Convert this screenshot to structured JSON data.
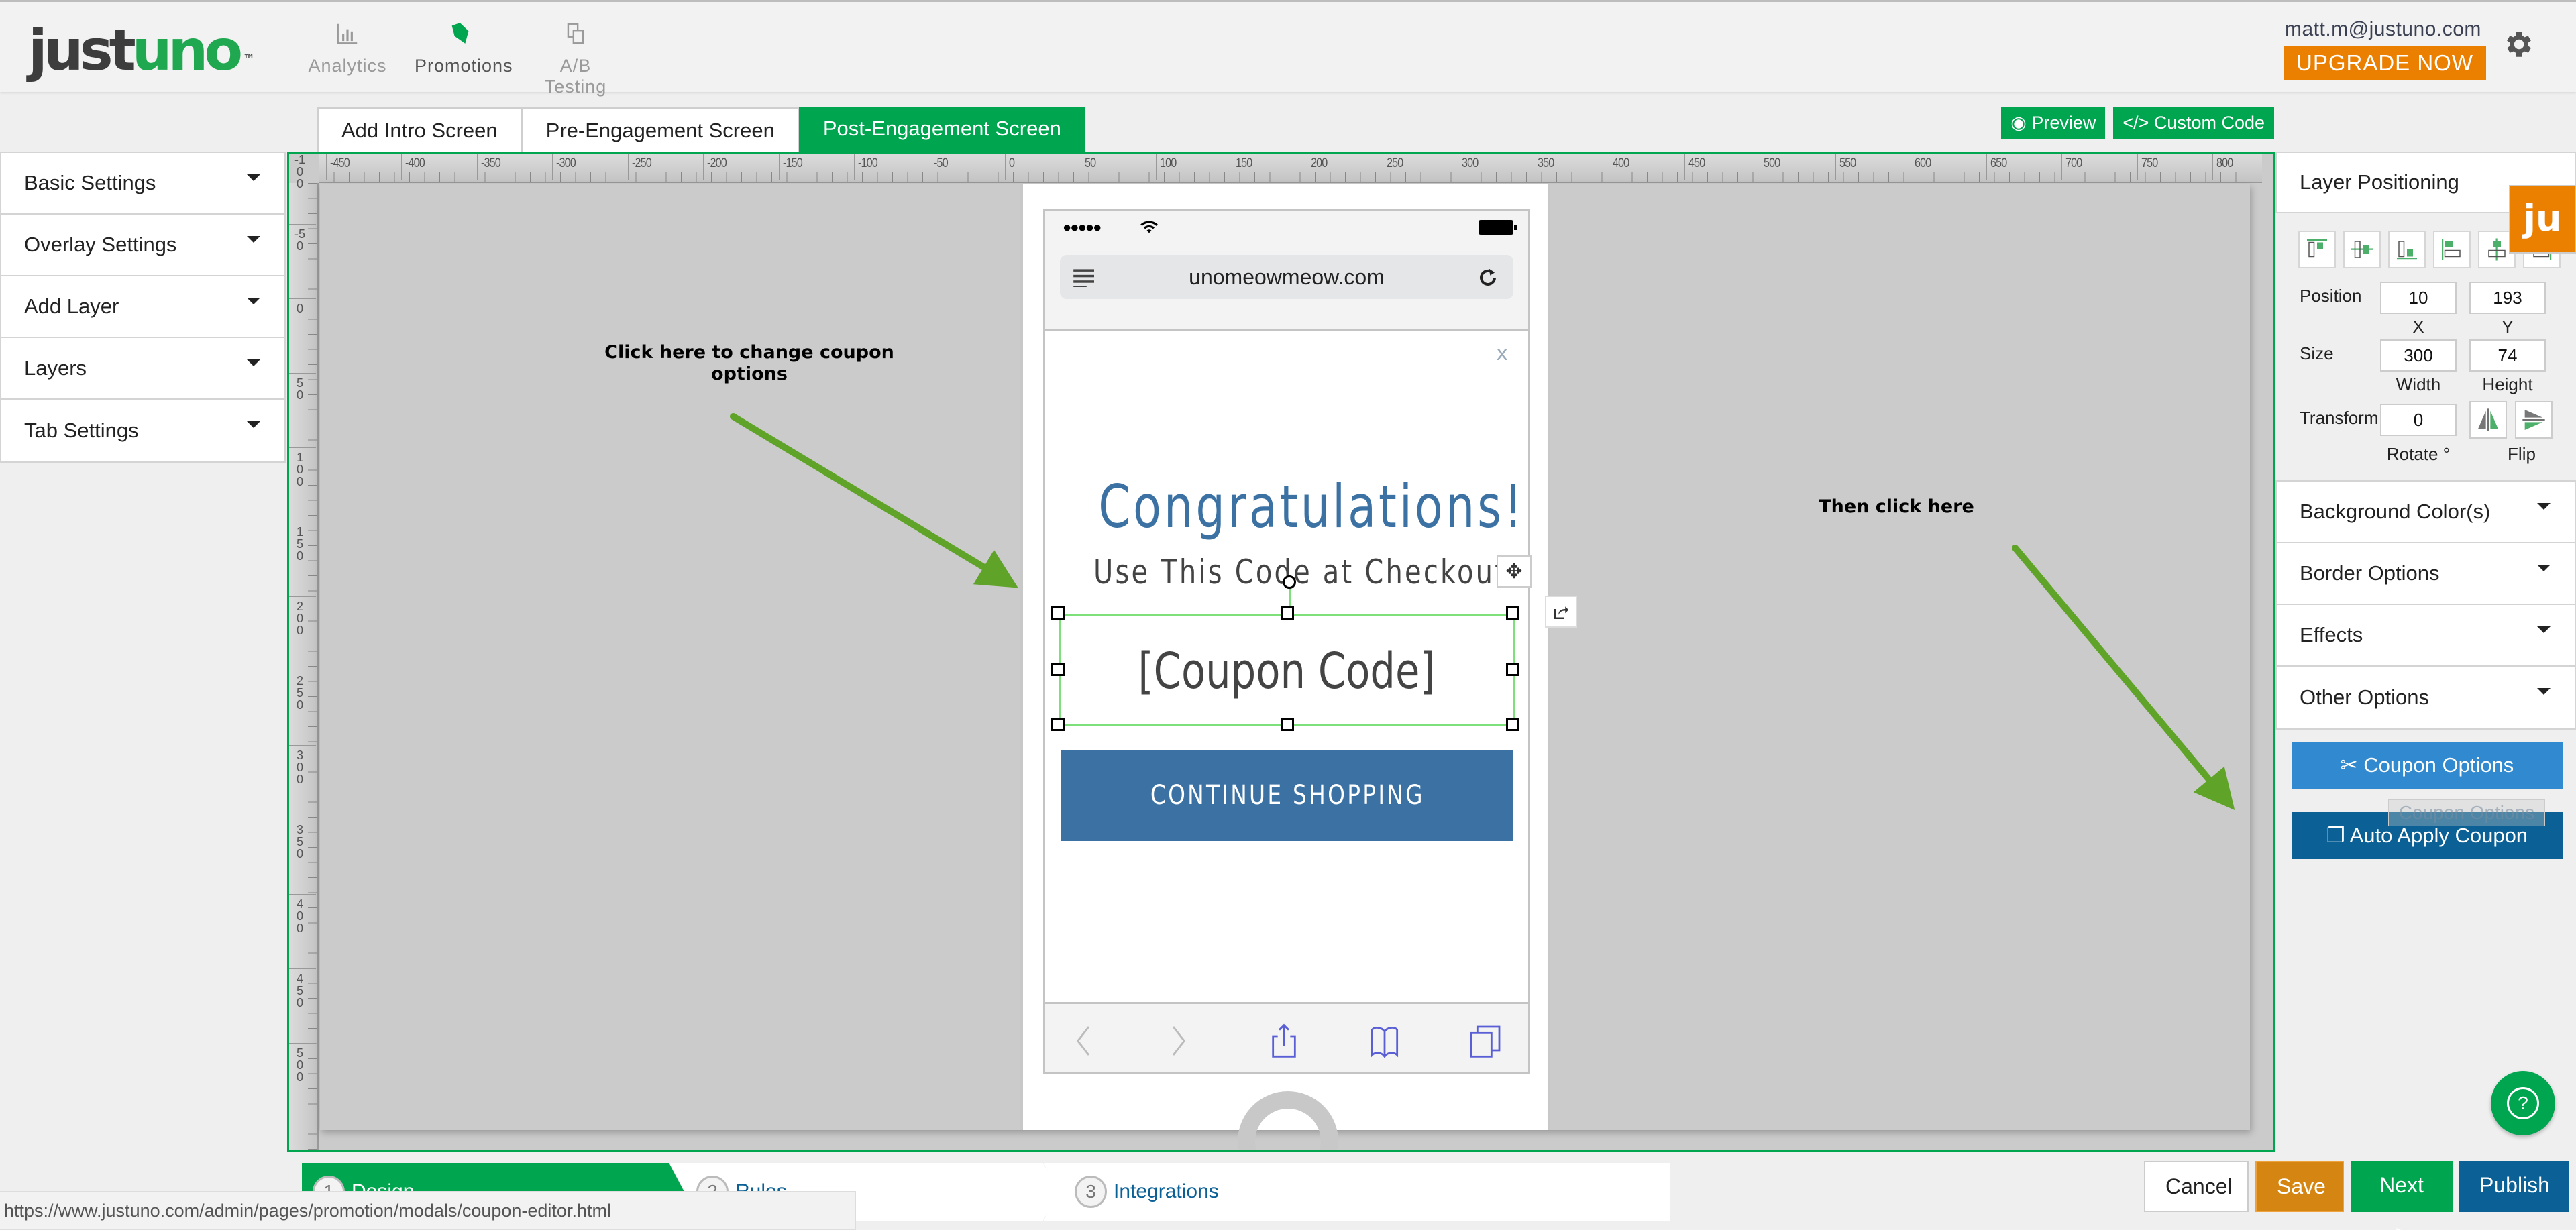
{
  "header": {
    "logo": {
      "part1": "just",
      "part2": "uno",
      "tm": "™"
    },
    "nav": [
      {
        "label": "Analytics",
        "icon": "bar-chart-icon"
      },
      {
        "label": "Promotions",
        "icon": "tag-icon",
        "active": true
      },
      {
        "label": "A/B Testing",
        "icon": "copy-pages-icon"
      }
    ],
    "user_email": "matt.m@justuno.com",
    "upgrade_label": "UPGRADE NOW",
    "settings_icon": "gear-icon"
  },
  "screen_tabs": [
    {
      "label": "Add Intro Screen",
      "active": false
    },
    {
      "label": "Pre-Engagement Screen",
      "active": false
    },
    {
      "label": "Post-Engagement Screen",
      "active": true
    }
  ],
  "top_actions": {
    "preview_label": "Preview",
    "custom_code_label": "Custom Code"
  },
  "left_sidebar": {
    "items": [
      {
        "label": "Basic Settings"
      },
      {
        "label": "Overlay Settings"
      },
      {
        "label": "Add Layer"
      },
      {
        "label": "Layers"
      },
      {
        "label": "Tab Settings"
      }
    ]
  },
  "rulers": {
    "top": [
      "-450",
      "-400",
      "-350",
      "-300",
      "-250",
      "-200",
      "-150",
      "-100",
      "-50",
      "0",
      "50",
      "100",
      "150",
      "200",
      "250",
      "300",
      "350",
      "400",
      "450",
      "500",
      "550",
      "600",
      "650",
      "700",
      "750",
      "800"
    ],
    "left": [
      "-100",
      "-50",
      "0",
      "50",
      "100",
      "150",
      "200",
      "250",
      "300",
      "350",
      "400",
      "450",
      "500"
    ]
  },
  "annotations": {
    "left": "Click here to change coupon options",
    "right": "Then click here"
  },
  "phone": {
    "url": "unomeowmeow.com",
    "close": "x",
    "headline": "Congratulations!",
    "subline": "Use This Code at Checkout",
    "coupon_placeholder": "[Coupon Code]",
    "cta": "CONTINUE SHOPPING",
    "signal": "●●●●●"
  },
  "right_panel": {
    "title": "Layer Positioning",
    "position_label": "Position",
    "x_value": "10",
    "y_value": "193",
    "x_label": "X",
    "y_label": "Y",
    "size_label": "Size",
    "width_value": "300",
    "height_value": "74",
    "width_label": "Width",
    "height_label": "Height",
    "transform_label": "Transform",
    "rotate_value": "0",
    "rotate_label": "Rotate °",
    "flip_label": "Flip",
    "accordions": [
      {
        "label": "Background Color(s)"
      },
      {
        "label": "Border Options"
      },
      {
        "label": "Effects"
      },
      {
        "label": "Other Options"
      }
    ],
    "coupon_options_label": "Coupon Options",
    "auto_apply_label": "Auto Apply Coupon",
    "tooltip": "Coupon Options",
    "badge": "ju",
    "help": "?"
  },
  "steps": [
    {
      "num": "1",
      "label": "Design",
      "active": true
    },
    {
      "num": "2",
      "label": "Rules"
    },
    {
      "num": "3",
      "label": "Integrations"
    }
  ],
  "status_url": "https://www.justuno.com/admin/pages/promotion/modals/coupon-editor.html",
  "footer": {
    "cancel": "Cancel",
    "save": "Save",
    "next": "Next >",
    "publish": "Publish"
  },
  "colors": {
    "brand_green": "#00a54f",
    "orange": "#ea7f00",
    "blue": "#318acf",
    "dark_blue": "#0b6196",
    "headline_blue": "#3b72a3"
  }
}
